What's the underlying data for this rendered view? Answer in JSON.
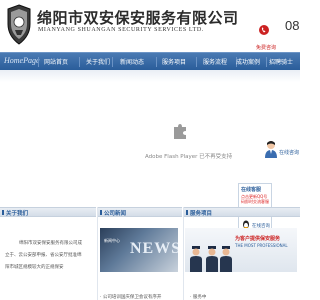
{
  "header": {
    "company_cn": "绵阳市双安保安服务有限公司",
    "company_en": "MIANYANG SHUANGAN SECURITY SERVICES LTD.",
    "phone_label": "免费咨询",
    "phone_number": "08"
  },
  "nav": {
    "homepage": "HomePage",
    "items": [
      "网站首页",
      "关于我们",
      "新闻动态",
      "服务项目",
      "服务流程",
      "成功案例",
      "招聘骑士"
    ]
  },
  "flash": {
    "message": "Adobe Flash Player 已不再受支持"
  },
  "online_service": {
    "button": "在线咨询",
    "box_title": "在线客服",
    "notice": "点击更新QQ号码即时交流客服",
    "qq_label": "在线咨询"
  },
  "sections": {
    "about": {
      "title": "关于我们",
      "text": "绵阳市双安保安服务有限公司成立于、云公安部申报、省公安厅批准绵阳市城区规模较大的正规保安"
    },
    "news": {
      "title": "公司新闻",
      "thumb_label": "新闻中心",
      "thumb_word": "NEWS",
      "footer": "· 公司培训国庆保卫会议有序开"
    },
    "services": {
      "title": "服务项目",
      "thumb_line1": "为客户提供保安服务",
      "thumb_line2": "THE MOST PROFESSIONAL",
      "footer": "· 服务中"
    }
  },
  "colors": {
    "nav_blue": "#2a5d9a",
    "accent_red": "#cc2222"
  }
}
